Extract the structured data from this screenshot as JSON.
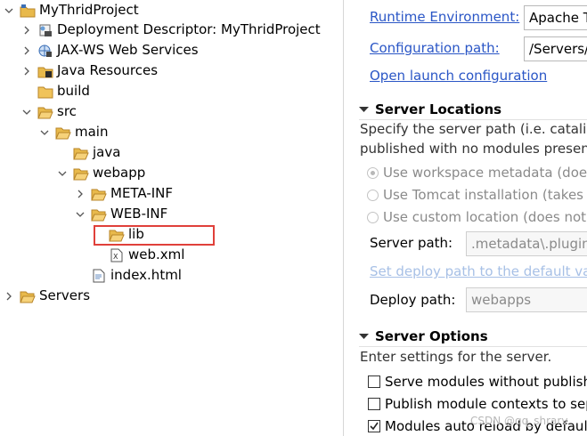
{
  "tree": {
    "items": [
      {
        "label": "MyThridProject",
        "icon": "project-folder-icon",
        "twisty": "expanded"
      },
      {
        "label": "Deployment Descriptor: MyThridProject",
        "icon": "deployment-descriptor-icon",
        "twisty": "collapsed"
      },
      {
        "label": "JAX-WS Web Services",
        "icon": "web-services-icon",
        "twisty": "collapsed"
      },
      {
        "label": "Java Resources",
        "icon": "java-resources-icon",
        "twisty": "collapsed"
      },
      {
        "label": "build",
        "icon": "folder-icon",
        "twisty": "none"
      },
      {
        "label": "src",
        "icon": "folder-open-icon",
        "twisty": "expanded"
      },
      {
        "label": "main",
        "icon": "folder-open-icon",
        "twisty": "expanded"
      },
      {
        "label": "java",
        "icon": "folder-icon",
        "twisty": "none"
      },
      {
        "label": "webapp",
        "icon": "folder-open-icon",
        "twisty": "expanded"
      },
      {
        "label": "META-INF",
        "icon": "folder-icon",
        "twisty": "collapsed"
      },
      {
        "label": "WEB-INF",
        "icon": "folder-open-icon",
        "twisty": "expanded"
      },
      {
        "label": "lib",
        "icon": "folder-open-icon",
        "twisty": "none",
        "highlighted": true
      },
      {
        "label": "web.xml",
        "icon": "xml-file-icon",
        "twisty": "none"
      },
      {
        "label": "index.html",
        "icon": "html-file-icon",
        "twisty": "none"
      },
      {
        "label": "Servers",
        "icon": "folder-open-icon",
        "twisty": "collapsed"
      }
    ]
  },
  "editor": {
    "runtime_link": "Runtime Environment:",
    "runtime_value": "Apache T",
    "config_link": "Configuration path:",
    "config_value": "/Servers/",
    "open_launch_link": "Open launch configuration",
    "server_locations": {
      "title": "Server Locations",
      "description_line1": "Specify the server path (i.e. catalina",
      "description_line2": "published with no modules present",
      "radio1": "Use workspace metadata (does",
      "radio2": "Use Tomcat installation (takes c",
      "radio3": "Use custom location (does not",
      "server_path_label": "Server path:",
      "server_path_value": ".metadata\\.plugins",
      "set_deploy_link": "Set deploy path to the default val",
      "deploy_path_label": "Deploy path:",
      "deploy_path_value": "webapps"
    },
    "server_options": {
      "title": "Server Options",
      "description": "Enter settings for the server.",
      "check1": "Serve modules without publish",
      "check2": "Publish module contexts to sep",
      "check3": "Modules auto reload by default"
    }
  },
  "watermark": "CSDN @qq_shrarv"
}
